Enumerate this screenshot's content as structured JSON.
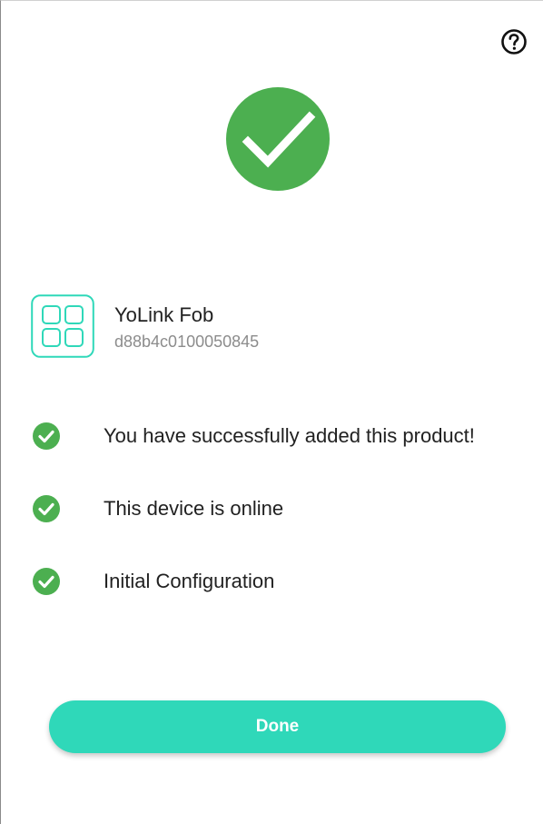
{
  "header": {
    "help_icon": "question-circle-icon"
  },
  "hero": {
    "icon": "check-circle-icon",
    "color": "#4caf50"
  },
  "device": {
    "icon": "device-grid-icon",
    "icon_color": "#2fd8b9",
    "name": "YoLink Fob",
    "id": "d88b4c0100050845"
  },
  "checklist": [
    {
      "icon": "check-circle-icon",
      "label": "You have successfully added this product!"
    },
    {
      "icon": "check-circle-icon",
      "label": "This device is online"
    },
    {
      "icon": "check-circle-icon",
      "label": "Initial Configuration"
    }
  ],
  "actions": {
    "done_label": "Done",
    "done_color": "#2fd8b9"
  }
}
